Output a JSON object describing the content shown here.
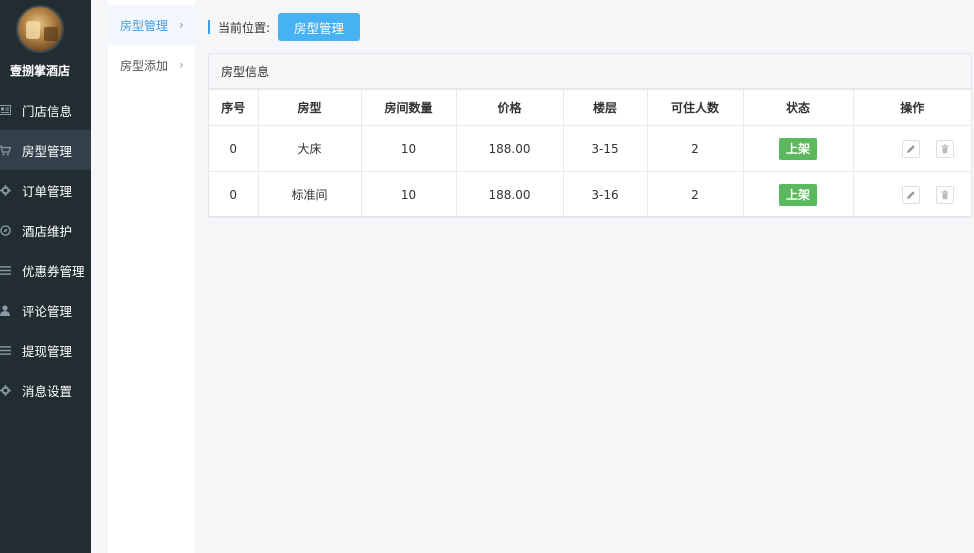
{
  "sidebar": {
    "hotel_name": "壹捌掌酒店",
    "items": [
      {
        "label": "门店信息",
        "icon": "store-icon"
      },
      {
        "label": "房型管理",
        "icon": "cart-icon"
      },
      {
        "label": "订单管理",
        "icon": "gear-icon"
      },
      {
        "label": "酒店维护",
        "icon": "compass-icon"
      },
      {
        "label": "优惠券管理",
        "icon": "list-icon"
      },
      {
        "label": "评论管理",
        "icon": "user-icon"
      },
      {
        "label": "提现管理",
        "icon": "list-icon"
      },
      {
        "label": "消息设置",
        "icon": "gear-icon"
      }
    ],
    "active_index": 1
  },
  "submenu": {
    "items": [
      {
        "label": "房型管理"
      },
      {
        "label": "房型添加"
      }
    ],
    "active_index": 0
  },
  "breadcrumb": {
    "label": "当前位置:",
    "current": "房型管理"
  },
  "panel": {
    "title": "房型信息",
    "columns": [
      "序号",
      "房型",
      "房间数量",
      "价格",
      "楼层",
      "可住人数",
      "状态",
      "操作"
    ],
    "rows": [
      {
        "id": "0",
        "type": "大床",
        "count": "10",
        "price": "188.00",
        "floor": "3-15",
        "capacity": "2",
        "status": "上架"
      },
      {
        "id": "0",
        "type": "标准间",
        "count": "10",
        "price": "188.00",
        "floor": "3-16",
        "capacity": "2",
        "status": "上架"
      }
    ]
  },
  "colors": {
    "sidebar_bg": "#222d32",
    "accent": "#46b1f3",
    "status_green": "#5cb85c"
  }
}
